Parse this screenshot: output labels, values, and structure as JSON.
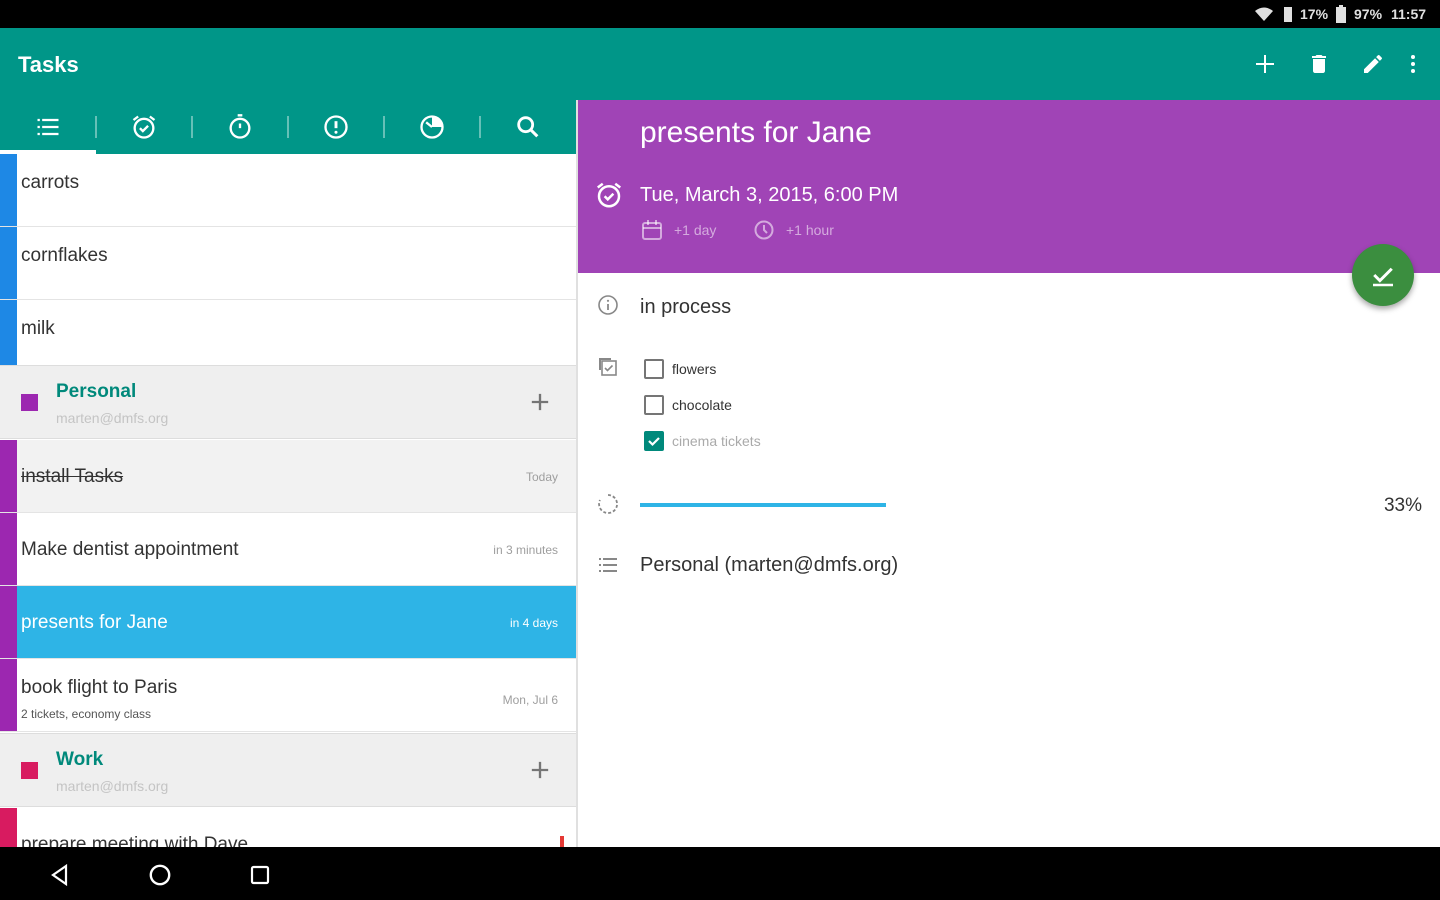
{
  "status_bar": {
    "signal_text": "17%",
    "battery_text": "97%",
    "time": "11:57",
    "icons": [
      "wifi-icon",
      "signal-icon",
      "battery-icon"
    ]
  },
  "app_bar": {
    "title": "Tasks",
    "actions": [
      "add-icon",
      "delete-icon",
      "edit-icon",
      "more-vert-icon"
    ]
  },
  "tabs": [
    {
      "name": "list-icon",
      "selected": true
    },
    {
      "name": "alarm-check-icon",
      "selected": false
    },
    {
      "name": "timer-icon",
      "selected": false
    },
    {
      "name": "priority-icon",
      "selected": false
    },
    {
      "name": "progress-icon",
      "selected": false
    },
    {
      "name": "search-icon",
      "selected": false
    }
  ],
  "list": {
    "items_top": [
      {
        "title": "carrots",
        "color": "#1e88e5"
      },
      {
        "title": "cornflakes",
        "color": "#1e88e5"
      },
      {
        "title": "milk",
        "color": "#1e88e5"
      }
    ],
    "groups": [
      {
        "name": "Personal",
        "email": "marten@dmfs.org",
        "color": "#9c27b0",
        "items": [
          {
            "title": "install Tasks",
            "due": "Today",
            "done": true
          },
          {
            "title": "Make dentist appointment",
            "due": "in 3 minutes"
          },
          {
            "title": "presents for Jane",
            "due": "in 4 days",
            "selected": true
          },
          {
            "title": "book flight to Paris",
            "subtitle": "2 tickets, economy class",
            "due": "Mon, Jul 6"
          }
        ]
      },
      {
        "name": "Work",
        "email": "marten@dmfs.org",
        "color": "#d81b60",
        "items": [
          {
            "title": "prepare meeting with Dave",
            "due": ""
          }
        ]
      }
    ]
  },
  "detail": {
    "title": "presents for Jane",
    "due_date": "Tue, March 3, 2015, 6:00 PM",
    "chip_day": "+1 day",
    "chip_hour": "+1 hour",
    "header_color": "#a044b6",
    "status": "in process",
    "checklist": [
      {
        "label": "flowers",
        "checked": false
      },
      {
        "label": "chocolate",
        "checked": false
      },
      {
        "label": "cinema tickets",
        "checked": true
      }
    ],
    "progress_value": 0.33,
    "progress_text": "33%",
    "list_name": "Personal (marten@dmfs.org)"
  },
  "fab": {
    "icon": "check-icon",
    "color": "#3b8e3f"
  },
  "nav_bar": [
    "back-icon",
    "home-icon",
    "recents-icon"
  ]
}
